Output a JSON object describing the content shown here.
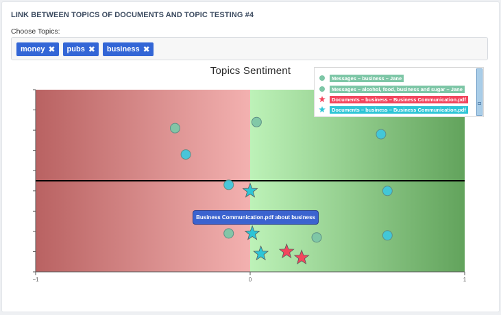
{
  "header": {
    "title": "LINK BETWEEN TOPICS OF DOCUMENTS AND TOPIC TESTING #4"
  },
  "topics": {
    "label": "Choose Topics:",
    "tags": [
      {
        "label": "money",
        "remove": "✖"
      },
      {
        "label": "pubs",
        "remove": "✖"
      },
      {
        "label": "business",
        "remove": "✖"
      }
    ]
  },
  "tooltip": {
    "text": "Business Communication.pdf about business"
  },
  "chart_data": {
    "type": "scatter",
    "title": "Topics Sentiment",
    "xlim": [
      -1,
      1
    ],
    "ylim": [
      0,
      9
    ],
    "x_ticks": [
      {
        "value": -1,
        "label": "−1"
      },
      {
        "value": 0,
        "label": "0"
      },
      {
        "value": 1,
        "label": "1"
      }
    ],
    "horizontal_line_y": 4.5,
    "background": {
      "negative": "#c26565",
      "positive": "#62a35c"
    },
    "grid": false,
    "legend_position": "top-right",
    "series": [
      {
        "name": "Messages – business – Jane",
        "marker": "circle",
        "color": "#7dc6a6",
        "points": [
          {
            "x": -0.35,
            "y": 7.1
          },
          {
            "x": 0.03,
            "y": 7.4
          },
          {
            "x": -0.1,
            "y": 1.9
          },
          {
            "x": 0.31,
            "y": 1.7
          }
        ]
      },
      {
        "name": "Messages – alcohol, food, business and sugar – Jane",
        "marker": "circle",
        "color": "#3fc7dc",
        "points": [
          {
            "x": 0.61,
            "y": 6.8
          },
          {
            "x": -0.3,
            "y": 5.8
          },
          {
            "x": -0.1,
            "y": 4.3
          },
          {
            "x": 0.64,
            "y": 4.0
          },
          {
            "x": 0.64,
            "y": 1.8
          }
        ]
      },
      {
        "name": "Documents – business – Business Communication.pdf",
        "marker": "star",
        "color": "#f2455d",
        "points": [
          {
            "x": 0.17,
            "y": 1.0
          },
          {
            "x": 0.24,
            "y": 0.7
          }
        ]
      },
      {
        "name": "Documents – business – Business Communication.pdf",
        "marker": "star",
        "color": "#2ec5d6",
        "points": [
          {
            "x": 0.0,
            "y": 4.0
          },
          {
            "x": 0.01,
            "y": 1.9
          },
          {
            "x": 0.05,
            "y": 0.9
          }
        ]
      }
    ]
  }
}
